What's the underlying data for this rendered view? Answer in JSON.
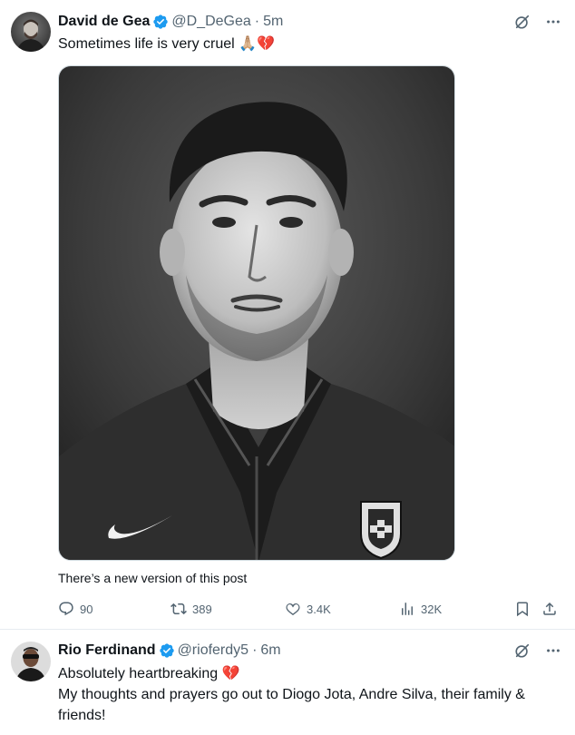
{
  "tweets": [
    {
      "name": "David de Gea",
      "handle": "@D_DeGea",
      "separator": "·",
      "time": "5m",
      "text": "Sometimes life is very cruel 🙏🏼💔",
      "new_version_notice": "There’s a new version of this post",
      "stats": {
        "replies": "90",
        "reposts": "389",
        "likes": "3.4K",
        "views": "32K"
      }
    },
    {
      "name": "Rio Ferdinand",
      "handle": "@rioferdy5",
      "separator": "·",
      "time": "6m",
      "text_line1": "Absolutely heartbreaking 💔",
      "text_line2": "My thoughts and prayers go out to Diogo Jota, Andre Silva, their family & friends!"
    }
  ],
  "colors": {
    "verified": "#1d9bf0",
    "secondary_text": "#536471",
    "divider": "#e6ecf0"
  },
  "icons": [
    "verified-badge-icon",
    "grok-icon",
    "more-icon",
    "reply-icon",
    "retweet-icon",
    "like-icon",
    "views-icon",
    "bookmark-icon",
    "share-icon"
  ]
}
